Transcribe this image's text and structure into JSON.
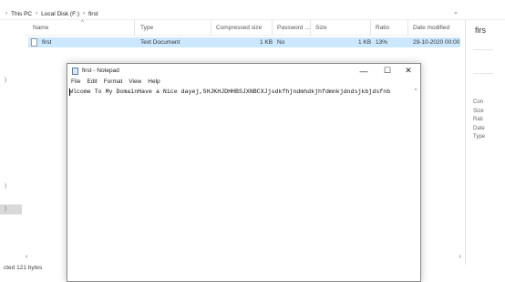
{
  "breadcrumb": {
    "items": [
      "This PC",
      "Local Disk (F:)",
      "first"
    ],
    "separator": "›"
  },
  "explorer": {
    "columns": [
      "Name",
      "Type",
      "Compressed size",
      "Password ...",
      "Size",
      "Ratio",
      "Date modified"
    ],
    "sort_indicator": "^",
    "row": {
      "name": "first",
      "type": "Text Document",
      "compressed_size": "1 KB",
      "password": "No",
      "size": "1 KB",
      "ratio": "13%",
      "date_modified": "29-10-2020 00:00"
    },
    "status_text": "cted  121 bytes",
    "details_pane": {
      "title": "firs",
      "meta": [
        "Con",
        "Size",
        "Rati",
        "Date",
        "Type"
      ]
    },
    "nav_marks": [
      ")",
      ")",
      ")"
    ]
  },
  "notepad": {
    "title": "first - Notepad",
    "menus": [
      "File",
      "Edit",
      "Format",
      "View",
      "Help"
    ],
    "content": "Wlcome To My DomainHave a Nice dayej,SHJKHJDHHBSJXNBCXJjsdkfhjndmhdkjhfdmnkjdndsjkbjdsfnb"
  },
  "icons": {
    "minimize": "—",
    "maximize": "☐",
    "close": "✕",
    "scroll_left": "‹",
    "scroll_right": "›",
    "scroll_up": "^",
    "chevron": "⌄"
  }
}
